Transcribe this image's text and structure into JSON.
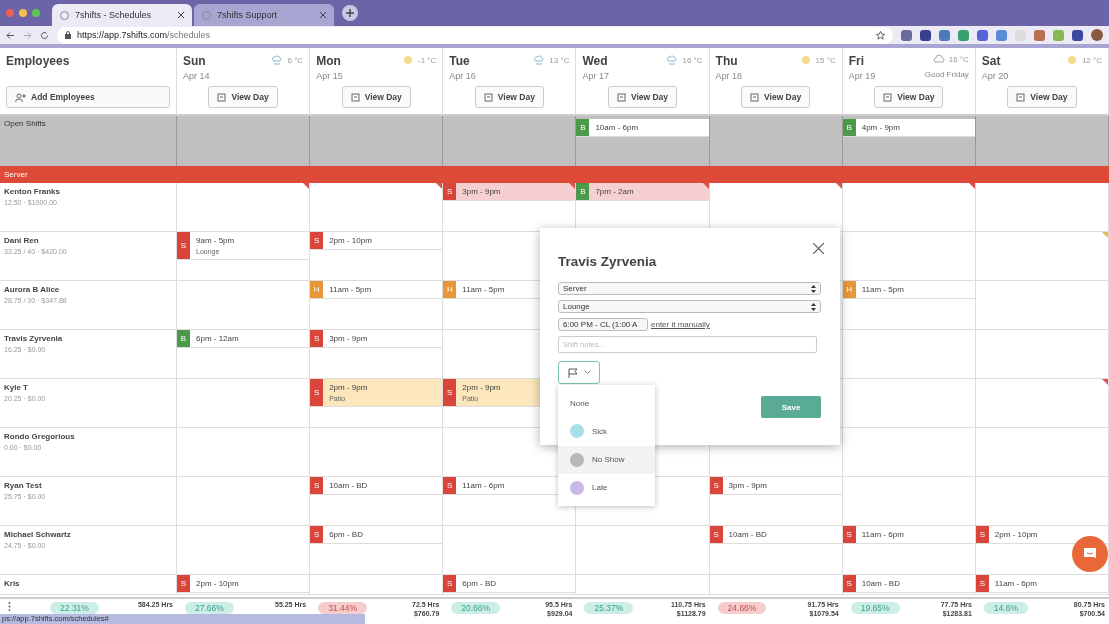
{
  "browser": {
    "tabs": [
      {
        "title": "7shifts - Schedules",
        "selected": true
      },
      {
        "title": "7shifts Support",
        "selected": false
      }
    ],
    "url_host": "https://app.7shifts.com",
    "url_path": "/schedules",
    "status_url": "ps://app.7shifts.com/schedules#"
  },
  "employees_header": {
    "title": "Employees",
    "add_button": "Add Employees"
  },
  "days": [
    {
      "name": "Sun",
      "date": "Apr 14",
      "weather": {
        "kind": "rain"
      },
      "temp": "6 °C",
      "button": "View Day"
    },
    {
      "name": "Mon",
      "date": "Apr 15",
      "weather": {
        "kind": "sun"
      },
      "temp": "-1 °C",
      "button": "View Day"
    },
    {
      "name": "Tue",
      "date": "Apr 16",
      "weather": {
        "kind": "rain"
      },
      "temp": "13 °C",
      "button": "View Day"
    },
    {
      "name": "Wed",
      "date": "Apr 17",
      "weather": {
        "kind": "rain"
      },
      "temp": "16 °C",
      "button": "View Day"
    },
    {
      "name": "Thu",
      "date": "Apr 18",
      "weather": {
        "kind": "sun"
      },
      "temp": "15 °C",
      "button": "View Day"
    },
    {
      "name": "Fri",
      "date": "Apr 19",
      "weather": {
        "kind": "cloud"
      },
      "temp": "16 °C",
      "holiday": "Good Friday",
      "button": "View Day"
    },
    {
      "name": "Sat",
      "date": "Apr 20",
      "weather": {
        "kind": "sun"
      },
      "temp": "12 °C",
      "button": "View Day"
    }
  ],
  "open_shifts": {
    "label": "Open Shifts",
    "cells": [
      {},
      {},
      {},
      {
        "badge": "B",
        "color": "#4a9a4a",
        "time": "10am - 6pm"
      },
      {},
      {
        "badge": "B",
        "color": "#4a9a4a",
        "time": "4pm - 9pm"
      },
      {}
    ]
  },
  "section": {
    "label": "Server"
  },
  "employees": [
    {
      "name": "Kenton Franks",
      "stats": "12.50 · $1000.00",
      "cells": [
        {
          "flag": {
            "color": "#d9534f"
          }
        },
        {
          "flag": {
            "color": "#d9534f"
          }
        },
        {
          "badge": "S",
          "color": "#d9453a",
          "time": "3pm - 9pm",
          "tint": {
            "color": "#f6d0d0"
          },
          "flag": {
            "color": "#d9534f"
          }
        },
        {
          "badge": "B",
          "color": "#4a9a4a",
          "time": "7pm - 2am",
          "tint": {
            "color": "#f6d0d0"
          },
          "flag": {
            "color": "#d9534f"
          }
        },
        {
          "flag": {
            "color": "#d9534f"
          }
        },
        {
          "flag": {
            "color": "#d9534f"
          }
        },
        {}
      ]
    },
    {
      "name": "Dani Ren",
      "stats": "33.25 / 40 · $420.00",
      "cells": [
        {
          "badge": "S",
          "color": "#d9453a",
          "time": "9am - 5pm",
          "note": "Lounge"
        },
        {
          "badge": "S",
          "color": "#d9453a",
          "time": "2pm - 10pm"
        },
        {},
        {
          "under_dialog": true
        },
        {},
        {},
        {
          "flag": {
            "color": "#e8b84a"
          }
        }
      ]
    },
    {
      "name": "Aurora B Alice",
      "stats": "28.75 / 30 · $347.88",
      "cells": [
        {},
        {
          "badge": "H",
          "color": "#e8963a",
          "time": "11am - 5pm"
        },
        {
          "badge": "H",
          "color": "#e8963a",
          "time": "11am - 5pm"
        },
        {
          "under_dialog": true
        },
        {},
        {
          "badge": "H",
          "color": "#e8963a",
          "time": "11am - 5pm"
        },
        {}
      ]
    },
    {
      "name": "Travis Zyrvenia",
      "stats": "16.25 · $0.00",
      "cells": [
        {
          "badge": "B",
          "color": "#4a9a4a",
          "time": "6pm - 12am"
        },
        {
          "badge": "S",
          "color": "#d9453a",
          "time": "3pm - 9pm"
        },
        {},
        {
          "under_dialog": true
        },
        {},
        {},
        {}
      ]
    },
    {
      "name": "Kyle T",
      "stats": "20.25 · $0.00",
      "cells": [
        {},
        {
          "badge": "S",
          "color": "#d9453a",
          "time": "2pm - 9pm",
          "note": "Patio",
          "tint": {
            "color": "#fbe7bb"
          }
        },
        {
          "badge": "S",
          "color": "#d9453a",
          "time": "2pm - 9pm",
          "note": "Patio",
          "tint": {
            "color": "#fbe7bb"
          }
        },
        {
          "under_dialog": true
        },
        {},
        {},
        {
          "flag": {
            "color": "#d9534f"
          }
        }
      ]
    },
    {
      "name": "Rondo Gregorious",
      "stats": "0.00 · $0.00",
      "cells": [
        {},
        {},
        {},
        {},
        {},
        {},
        {}
      ]
    },
    {
      "name": "Ryan Test",
      "stats": "25.75 · $0.00",
      "cells": [
        {},
        {
          "badge": "S",
          "color": "#d9453a",
          "time": "10am - BD"
        },
        {
          "badge": "S",
          "color": "#d9453a",
          "time": "11am - 6pm"
        },
        {},
        {
          "badge": "S",
          "color": "#d9453a",
          "time": "3pm - 9pm"
        },
        {},
        {}
      ]
    },
    {
      "name": "Michael Schwartz",
      "stats": "24.75 · $0.00",
      "cells": [
        {},
        {
          "badge": "S",
          "color": "#d9453a",
          "time": "6pm - BD"
        },
        {},
        {},
        {
          "badge": "S",
          "color": "#d9453a",
          "time": "10am - BD"
        },
        {
          "badge": "S",
          "color": "#d9453a",
          "time": "11am - 6pm"
        },
        {
          "badge": "S",
          "color": "#d9453a",
          "time": "2pm - 10pm"
        }
      ]
    },
    {
      "name": "Kris",
      "cells": [
        {
          "badge": "S",
          "color": "#d9453a",
          "time": "2pm - 10pm"
        },
        {},
        {
          "badge": "S",
          "color": "#d9453a",
          "time": "6pm - BD"
        },
        {},
        {},
        {
          "badge": "S",
          "color": "#d9453a",
          "time": "10am - BD"
        },
        {
          "badge": "S",
          "color": "#d9453a",
          "time": "11am - 6pm"
        }
      ]
    }
  ],
  "totals": [
    {
      "percent": "22.31%",
      "over": false,
      "hours": "584.25 Hrs"
    },
    {
      "percent": "27.66%",
      "over": false,
      "hours": "55.25 Hrs"
    },
    {
      "percent": "31.44%",
      "over": true,
      "hours": "72.5 Hrs",
      "cost": "$760.79"
    },
    {
      "percent": "20.66%",
      "over": false,
      "hours": "95.5 Hrs",
      "cost": "$929.04"
    },
    {
      "percent": "25.37%",
      "over": false,
      "hours": "110.75 Hrs",
      "cost": "$1128.79"
    },
    {
      "percent": "24.66%",
      "over": true,
      "hours": "91.75 Hrs",
      "cost": "$1079.54"
    },
    {
      "percent": "19.65%",
      "over": false,
      "hours": "77.75 Hrs",
      "cost": "$1283.81"
    },
    {
      "percent": "14.6%",
      "over": false,
      "hours": "80.75 Hrs",
      "cost": "$700.54"
    }
  ],
  "modal": {
    "title": "Travis Zyrvenia",
    "role": "Server",
    "location": "Lounge",
    "time": "6:00 PM - CL (1:00 A",
    "manual_link": "enter it manually",
    "notes_placeholder": "Shift notes...",
    "save": "Save",
    "flag_options": [
      {
        "label": "None",
        "selected": false
      },
      {
        "label": "Sick",
        "color": "#a8e0ea",
        "selected": false
      },
      {
        "label": "No Show",
        "color": "#b8b8b8",
        "selected": true
      },
      {
        "label": "Late",
        "color": "#c8b8e8",
        "selected": false
      }
    ]
  }
}
